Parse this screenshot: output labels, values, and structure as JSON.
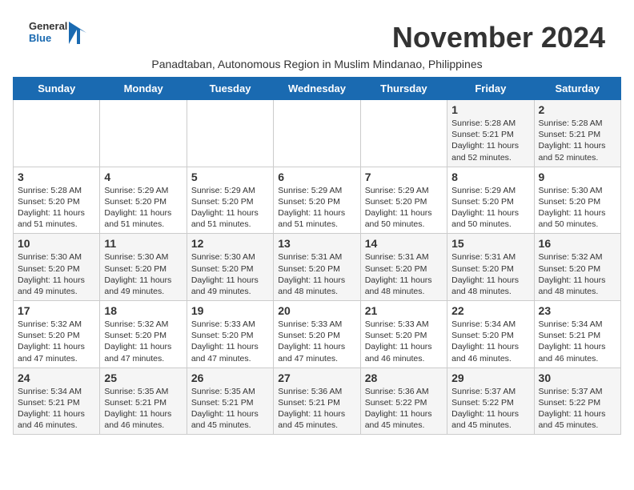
{
  "header": {
    "logo_line1": "General",
    "logo_line2": "Blue",
    "month_title": "November 2024",
    "subtitle": "Panadtaban, Autonomous Region in Muslim Mindanao, Philippines"
  },
  "weekdays": [
    "Sunday",
    "Monday",
    "Tuesday",
    "Wednesday",
    "Thursday",
    "Friday",
    "Saturday"
  ],
  "weeks": [
    [
      {
        "day": "",
        "info": ""
      },
      {
        "day": "",
        "info": ""
      },
      {
        "day": "",
        "info": ""
      },
      {
        "day": "",
        "info": ""
      },
      {
        "day": "",
        "info": ""
      },
      {
        "day": "1",
        "info": "Sunrise: 5:28 AM\nSunset: 5:21 PM\nDaylight: 11 hours\nand 52 minutes."
      },
      {
        "day": "2",
        "info": "Sunrise: 5:28 AM\nSunset: 5:21 PM\nDaylight: 11 hours\nand 52 minutes."
      }
    ],
    [
      {
        "day": "3",
        "info": "Sunrise: 5:28 AM\nSunset: 5:20 PM\nDaylight: 11 hours\nand 51 minutes."
      },
      {
        "day": "4",
        "info": "Sunrise: 5:29 AM\nSunset: 5:20 PM\nDaylight: 11 hours\nand 51 minutes."
      },
      {
        "day": "5",
        "info": "Sunrise: 5:29 AM\nSunset: 5:20 PM\nDaylight: 11 hours\nand 51 minutes."
      },
      {
        "day": "6",
        "info": "Sunrise: 5:29 AM\nSunset: 5:20 PM\nDaylight: 11 hours\nand 51 minutes."
      },
      {
        "day": "7",
        "info": "Sunrise: 5:29 AM\nSunset: 5:20 PM\nDaylight: 11 hours\nand 50 minutes."
      },
      {
        "day": "8",
        "info": "Sunrise: 5:29 AM\nSunset: 5:20 PM\nDaylight: 11 hours\nand 50 minutes."
      },
      {
        "day": "9",
        "info": "Sunrise: 5:30 AM\nSunset: 5:20 PM\nDaylight: 11 hours\nand 50 minutes."
      }
    ],
    [
      {
        "day": "10",
        "info": "Sunrise: 5:30 AM\nSunset: 5:20 PM\nDaylight: 11 hours\nand 49 minutes."
      },
      {
        "day": "11",
        "info": "Sunrise: 5:30 AM\nSunset: 5:20 PM\nDaylight: 11 hours\nand 49 minutes."
      },
      {
        "day": "12",
        "info": "Sunrise: 5:30 AM\nSunset: 5:20 PM\nDaylight: 11 hours\nand 49 minutes."
      },
      {
        "day": "13",
        "info": "Sunrise: 5:31 AM\nSunset: 5:20 PM\nDaylight: 11 hours\nand 48 minutes."
      },
      {
        "day": "14",
        "info": "Sunrise: 5:31 AM\nSunset: 5:20 PM\nDaylight: 11 hours\nand 48 minutes."
      },
      {
        "day": "15",
        "info": "Sunrise: 5:31 AM\nSunset: 5:20 PM\nDaylight: 11 hours\nand 48 minutes."
      },
      {
        "day": "16",
        "info": "Sunrise: 5:32 AM\nSunset: 5:20 PM\nDaylight: 11 hours\nand 48 minutes."
      }
    ],
    [
      {
        "day": "17",
        "info": "Sunrise: 5:32 AM\nSunset: 5:20 PM\nDaylight: 11 hours\nand 47 minutes."
      },
      {
        "day": "18",
        "info": "Sunrise: 5:32 AM\nSunset: 5:20 PM\nDaylight: 11 hours\nand 47 minutes."
      },
      {
        "day": "19",
        "info": "Sunrise: 5:33 AM\nSunset: 5:20 PM\nDaylight: 11 hours\nand 47 minutes."
      },
      {
        "day": "20",
        "info": "Sunrise: 5:33 AM\nSunset: 5:20 PM\nDaylight: 11 hours\nand 47 minutes."
      },
      {
        "day": "21",
        "info": "Sunrise: 5:33 AM\nSunset: 5:20 PM\nDaylight: 11 hours\nand 46 minutes."
      },
      {
        "day": "22",
        "info": "Sunrise: 5:34 AM\nSunset: 5:20 PM\nDaylight: 11 hours\nand 46 minutes."
      },
      {
        "day": "23",
        "info": "Sunrise: 5:34 AM\nSunset: 5:21 PM\nDaylight: 11 hours\nand 46 minutes."
      }
    ],
    [
      {
        "day": "24",
        "info": "Sunrise: 5:34 AM\nSunset: 5:21 PM\nDaylight: 11 hours\nand 46 minutes."
      },
      {
        "day": "25",
        "info": "Sunrise: 5:35 AM\nSunset: 5:21 PM\nDaylight: 11 hours\nand 46 minutes."
      },
      {
        "day": "26",
        "info": "Sunrise: 5:35 AM\nSunset: 5:21 PM\nDaylight: 11 hours\nand 45 minutes."
      },
      {
        "day": "27",
        "info": "Sunrise: 5:36 AM\nSunset: 5:21 PM\nDaylight: 11 hours\nand 45 minutes."
      },
      {
        "day": "28",
        "info": "Sunrise: 5:36 AM\nSunset: 5:22 PM\nDaylight: 11 hours\nand 45 minutes."
      },
      {
        "day": "29",
        "info": "Sunrise: 5:37 AM\nSunset: 5:22 PM\nDaylight: 11 hours\nand 45 minutes."
      },
      {
        "day": "30",
        "info": "Sunrise: 5:37 AM\nSunset: 5:22 PM\nDaylight: 11 hours\nand 45 minutes."
      }
    ]
  ]
}
